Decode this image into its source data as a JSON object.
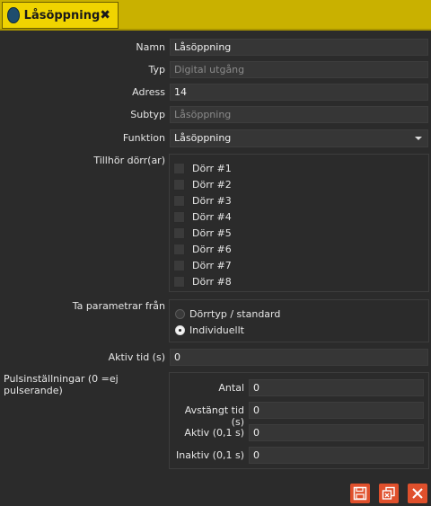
{
  "tab": {
    "title": "Låsöppning",
    "close_symbol": "✖"
  },
  "fields": {
    "namn": {
      "label": "Namn",
      "value": "Låsöppning"
    },
    "typ": {
      "label": "Typ",
      "value": "Digital utgång"
    },
    "adress": {
      "label": "Adress",
      "value": "14"
    },
    "subtyp": {
      "label": "Subtyp",
      "value": "Låsöppning"
    },
    "funktion": {
      "label": "Funktion",
      "value": "Låsöppning"
    }
  },
  "doors": {
    "label": "Tillhör dörr(ar)",
    "items": [
      "Dörr #1",
      "Dörr #2",
      "Dörr #3",
      "Dörr #4",
      "Dörr #5",
      "Dörr #6",
      "Dörr #7",
      "Dörr #8"
    ]
  },
  "params": {
    "label": "Ta parametrar från",
    "options": [
      "Dörrtyp / standard",
      "Individuellt"
    ],
    "selected": "Individuellt"
  },
  "aktiv_tid": {
    "label": "Aktiv tid (s)",
    "value": "0"
  },
  "pulse": {
    "label": "Pulsinställningar (0 =ej pulserande)",
    "antal": {
      "label": "Antal",
      "value": "0"
    },
    "avstangt": {
      "label": "Avstängt tid (s)",
      "value": "0"
    },
    "aktiv": {
      "label": "Aktiv (0,1 s)",
      "value": "0"
    },
    "inaktiv": {
      "label": "Inaktiv (0,1 s)",
      "value": "0"
    }
  },
  "colors": {
    "tab_bg": "#f0d400",
    "tabbar_bg": "#c9b100",
    "button": "#e0502c",
    "panel": "#2b2b2b"
  },
  "icons": {
    "tab": "door-lock-icon",
    "save": "save-icon",
    "copy": "copy-icon",
    "close": "close-icon"
  }
}
